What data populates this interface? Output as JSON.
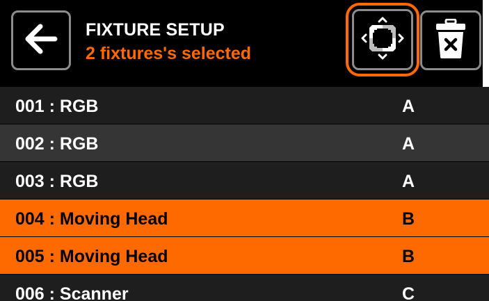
{
  "header": {
    "title": "FIXTURE SETUP",
    "subtitle": "2 fixtures's selected",
    "back_icon": "arrow-left-icon",
    "group_icon": "collapse-arrows-icon",
    "delete_icon": "trash-icon"
  },
  "colors": {
    "accent": "#ff6a00",
    "background": "#000000",
    "row_dark": "#1e1e1e",
    "row_mid": "#353535",
    "button_border": "#8c8c8c"
  },
  "fixtures": [
    {
      "name": "001 : RGB",
      "group": "A",
      "selected": false
    },
    {
      "name": "002 : RGB",
      "group": "A",
      "selected": false
    },
    {
      "name": "003 : RGB",
      "group": "A",
      "selected": false
    },
    {
      "name": "004 : Moving Head",
      "group": "B",
      "selected": true
    },
    {
      "name": "005 : Moving Head",
      "group": "B",
      "selected": true
    },
    {
      "name": "006 : Scanner",
      "group": "C",
      "selected": false
    }
  ]
}
